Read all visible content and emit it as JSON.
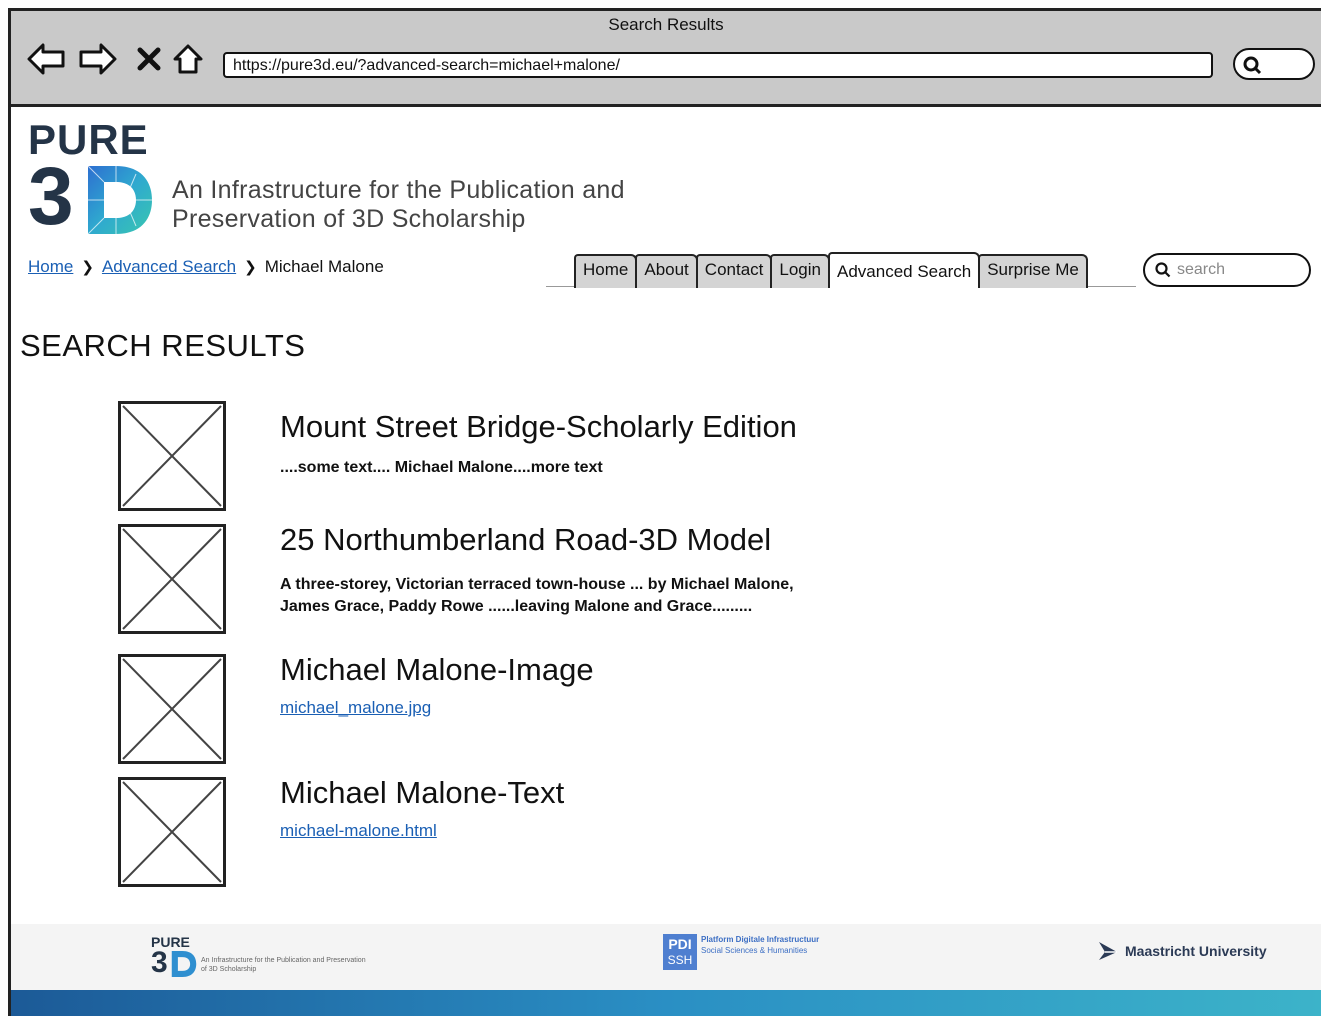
{
  "browser": {
    "title": "Search Results",
    "url": "https://pure3d.eu/?advanced-search=michael+malone/"
  },
  "header": {
    "logo_pure": "PURE",
    "logo_3": "3",
    "tagline_line1": "An Infrastructure for the Publication and",
    "tagline_line2": "Preservation of 3D Scholarship"
  },
  "breadcrumb": {
    "home": "Home",
    "advanced": "Advanced Search",
    "current": "Michael Malone"
  },
  "tabs": [
    {
      "label": "Home"
    },
    {
      "label": "About"
    },
    {
      "label": "Contact"
    },
    {
      "label": "Login"
    },
    {
      "label": "Advanced Search",
      "active": true
    },
    {
      "label": "Surprise Me"
    }
  ],
  "site_search": {
    "placeholder": "search"
  },
  "page_heading": "SEARCH RESULTS",
  "results": [
    {
      "title": "Mount Street Bridge-Scholarly Edition",
      "snippet": "....some text.... Michael Malone....more text"
    },
    {
      "title": "25 Northumberland Road-3D Model",
      "snippet": " A three-storey, Victorian terraced town-house ... by Michael Malone, James Grace, Paddy Rowe ......leaving Malone and Grace........."
    },
    {
      "title": "Michael Malone-Image",
      "link": "michael_malone.jpg"
    },
    {
      "title": "Michael Malone-Text",
      "link": "michael-malone.html"
    }
  ],
  "footer": {
    "pure": "PURE",
    "three": "3",
    "tagline": "An Infrastructure for the Publication and Preservation of 3D Scholarship",
    "pdi_box_top": "PDI",
    "pdi_box_bottom": "SSH",
    "pdi_line1": "Platform Digitale Infrastructuur",
    "pdi_line2": "Social Sciences & Humanities",
    "university": "Maastricht University"
  },
  "colors": {
    "link": "#1a5fb4",
    "logo_dark": "#243447",
    "chrome": "#c9c9c9"
  }
}
